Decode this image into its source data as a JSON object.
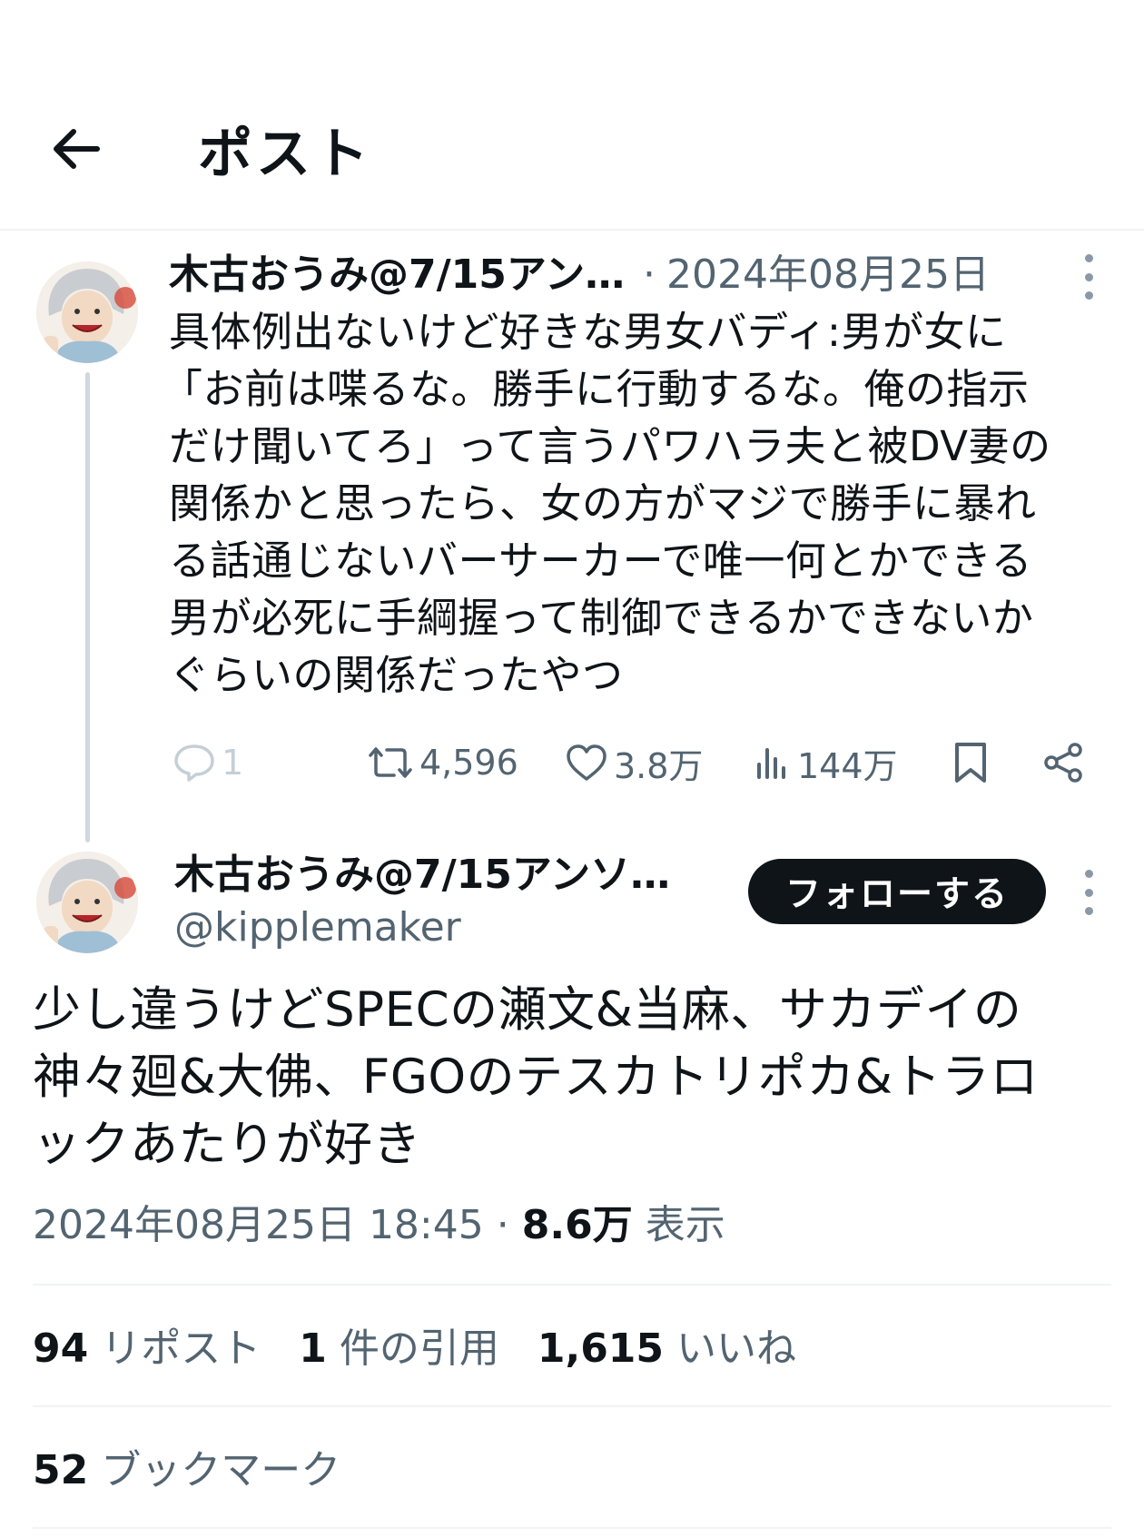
{
  "header": {
    "title": "ポスト",
    "back_icon": "arrow-left-icon"
  },
  "tweet1": {
    "author": "木古おうみ@7/15アン…",
    "separator": "·",
    "date": "2024年08月25日",
    "lines": [
      "具体例出ないけど好きな男女バディ:男が女に",
      "「お前は喋るな。勝手に行動するな。俺の指示",
      "だけ聞いてろ」って言うパワハラ夫と被DV妻の",
      "関係かと思ったら、女の方がマジで勝手に暴れ",
      "る話通じないバーサーカーで唯一何とかできる",
      "男が必死に手綱握って制御できるかできないか",
      "ぐらいの関係だったやつ"
    ],
    "actions": {
      "reply_count": "1",
      "repost_count": "4,596",
      "like_count": "3.8万",
      "view_count": "144万"
    }
  },
  "tweet2": {
    "author": "木古おうみ@7/15アンソ…",
    "handle": "@kipplemaker",
    "follow_label": "フォローする",
    "lines": [
      "少し違うけどSPECの瀬文&当麻、サカデイの",
      "神々廻&大佛、FGOのテスカトリポカ&トラロ",
      "ックあたりが好き"
    ],
    "timestamp": "2024年08月25日 18:45",
    "separator": "·",
    "views_count": "8.6万",
    "views_label": "表示",
    "stats": {
      "reposts_count": "94",
      "reposts_label": "リポスト",
      "quotes_count": "1",
      "quotes_label": "件の引用",
      "likes_count": "1,615",
      "likes_label": "いいね",
      "bookmarks_count": "52",
      "bookmarks_label": "ブックマーク"
    }
  },
  "colors": {
    "text": "#0f1419",
    "muted": "#536471",
    "divider": "#eff3f4",
    "thread_line": "#cfd9de",
    "button_bg": "#0f1419"
  }
}
